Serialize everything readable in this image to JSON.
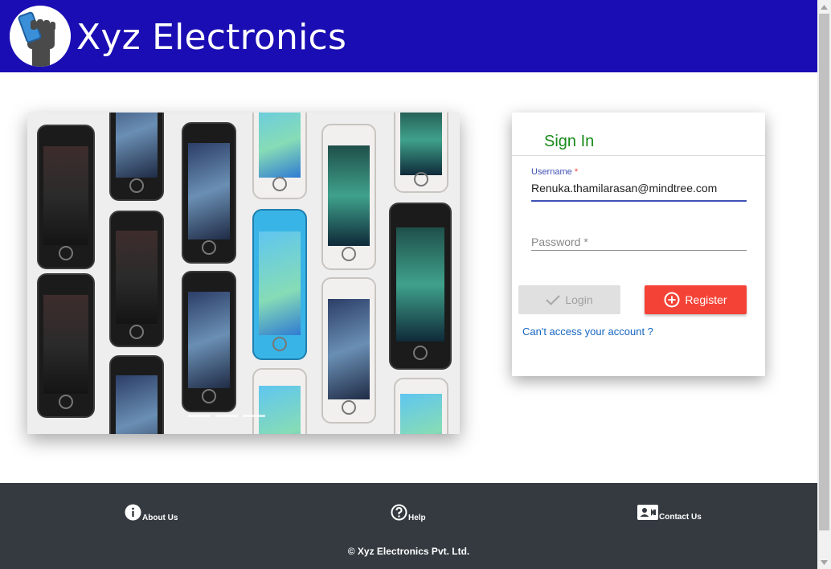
{
  "header": {
    "brand": "Xyz Electronics",
    "logo_icon": "fist-phone-logo-icon",
    "background": "#1a0db3"
  },
  "carousel": {
    "slide_count": 3,
    "active_slide": 1
  },
  "signin": {
    "title": "Sign In",
    "username_label": "Username",
    "username_required": "*",
    "username_value": "Renuka.thamilarasan@mindtree.com",
    "password_label": "Password *",
    "login_label": "Login",
    "register_label": "Register",
    "forgot_link": "Can't access your account ?",
    "title_color": "#1a8a1a",
    "register_color": "#f44336"
  },
  "footer": {
    "about_label": "About Us",
    "help_label": "Help",
    "contact_label": "Contact Us",
    "copyright": "© Xyz Electronics Pvt. Ltd.",
    "about_icon": "info-icon",
    "help_icon": "help-circle-icon",
    "contact_icon": "contact-card-icon",
    "background": "#343a40"
  }
}
